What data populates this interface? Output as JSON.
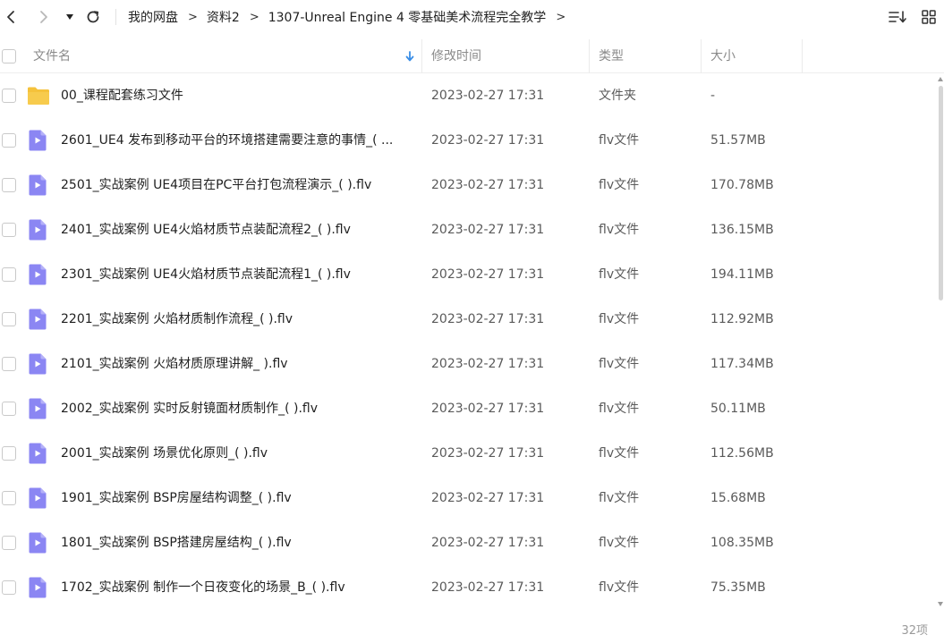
{
  "toolbar": {
    "back_icon": "chevron-left-icon",
    "forward_icon": "chevron-right-icon",
    "history_icon": "dropdown-triangle-icon",
    "refresh_icon": "refresh-icon",
    "sort_icon": "sort-list-icon",
    "view_icon": "grid-view-icon"
  },
  "breadcrumb": {
    "items": [
      "我的网盘",
      "资料2",
      "1307-Unreal Engine 4 零基础美术流程完全教学"
    ],
    "separator": ">"
  },
  "header": {
    "name": "文件名",
    "modified": "修改时间",
    "type": "类型",
    "size": "大小",
    "sort_indicator": "arrow-down-icon"
  },
  "colors": {
    "folder": "#f5c23b",
    "video": "#8b86f3",
    "accent": "#3a8ee6"
  },
  "files": [
    {
      "name": "00_课程配套练习文件",
      "date": "2023-02-27 17:31",
      "type": "文件夹",
      "size": "-",
      "icon": "folder-icon"
    },
    {
      "name": "2601_UE4 发布到移动平台的环境搭建需要注意的事情_( ...",
      "date": "2023-02-27 17:31",
      "type": "flv文件",
      "size": "51.57MB",
      "icon": "video-file-icon"
    },
    {
      "name": "2501_实战案例  UE4项目在PC平台打包流程演示_( ).flv",
      "date": "2023-02-27 17:31",
      "type": "flv文件",
      "size": "170.78MB",
      "icon": "video-file-icon"
    },
    {
      "name": "2401_实战案例  UE4火焰材质节点装配流程2_( ).flv",
      "date": "2023-02-27 17:31",
      "type": "flv文件",
      "size": "136.15MB",
      "icon": "video-file-icon"
    },
    {
      "name": "2301_实战案例  UE4火焰材质节点装配流程1_( ).flv",
      "date": "2023-02-27 17:31",
      "type": "flv文件",
      "size": "194.11MB",
      "icon": "video-file-icon"
    },
    {
      "name": "2201_实战案例  火焰材质制作流程_( ).flv",
      "date": "2023-02-27 17:31",
      "type": "flv文件",
      "size": "112.92MB",
      "icon": "video-file-icon"
    },
    {
      "name": "2101_实战案例  火焰材质原理讲解_ ).flv",
      "date": "2023-02-27 17:31",
      "type": "flv文件",
      "size": "117.34MB",
      "icon": "video-file-icon"
    },
    {
      "name": "2002_实战案例 实时反射镜面材质制作_( ).flv",
      "date": "2023-02-27 17:31",
      "type": "flv文件",
      "size": "50.11MB",
      "icon": "video-file-icon"
    },
    {
      "name": "2001_实战案例 场景优化原则_( ).flv",
      "date": "2023-02-27 17:31",
      "type": "flv文件",
      "size": "112.56MB",
      "icon": "video-file-icon"
    },
    {
      "name": "1901_实战案例 BSP房屋结构调整_( ).flv",
      "date": "2023-02-27 17:31",
      "type": "flv文件",
      "size": "15.68MB",
      "icon": "video-file-icon"
    },
    {
      "name": "1801_实战案例 BSP搭建房屋结构_( ).flv",
      "date": "2023-02-27 17:31",
      "type": "flv文件",
      "size": "108.35MB",
      "icon": "video-file-icon"
    },
    {
      "name": "1702_实战案例  制作一个日夜变化的场景_B_( ).flv",
      "date": "2023-02-27 17:31",
      "type": "flv文件",
      "size": "75.35MB",
      "icon": "video-file-icon"
    }
  ],
  "footer": {
    "count": "32项"
  }
}
